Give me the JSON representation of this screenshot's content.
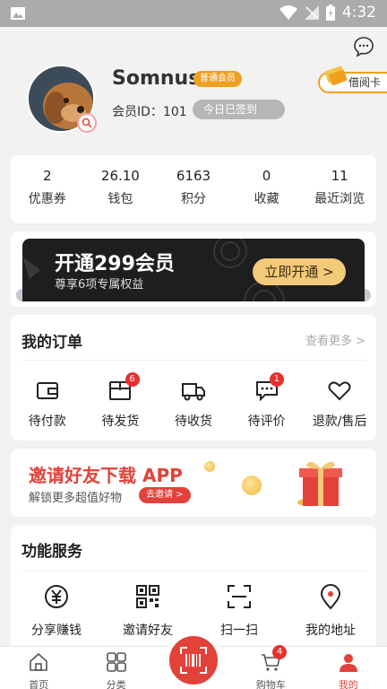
{
  "status_bar": {
    "time": "4:32"
  },
  "profile": {
    "username": "Somnus",
    "member_badge": "普通会员",
    "member_id": "会员ID：101",
    "signin_label": "今日已签到",
    "card_label": "借阅卡"
  },
  "stats": [
    {
      "value": "2",
      "label": "优惠券"
    },
    {
      "value": "26.10",
      "label": "钱包"
    },
    {
      "value": "6163",
      "label": "积分"
    },
    {
      "value": "0",
      "label": "收藏"
    },
    {
      "value": "11",
      "label": "最近浏览"
    }
  ],
  "vip": {
    "title": "开通299会员",
    "subtitle": "尊享6项专属权益",
    "button": "立即开通 >"
  },
  "orders": {
    "title": "我的订单",
    "more": "查看更多 >",
    "items": [
      {
        "label": "待付款",
        "icon": "wallet-icon",
        "badge": ""
      },
      {
        "label": "待发货",
        "icon": "box-icon",
        "badge": "6"
      },
      {
        "label": "待收货",
        "icon": "truck-icon",
        "badge": ""
      },
      {
        "label": "待评价",
        "icon": "comment-icon",
        "badge": "1"
      },
      {
        "label": "退款/售后",
        "icon": "heart-icon",
        "badge": ""
      }
    ]
  },
  "invite": {
    "title": "邀请好友下载 APP",
    "subtitle": "解锁更多超值好物",
    "button": "去邀请 >"
  },
  "services": {
    "title": "功能服务",
    "items": [
      {
        "label": "分享赚钱",
        "icon": "yen-icon"
      },
      {
        "label": "邀请好友",
        "icon": "qrcode-icon"
      },
      {
        "label": "扫一扫",
        "icon": "scan-icon"
      },
      {
        "label": "我的地址",
        "icon": "location-icon"
      }
    ]
  },
  "tabbar": {
    "items": [
      {
        "label": "首页",
        "icon": "home-icon"
      },
      {
        "label": "分类",
        "icon": "category-icon"
      },
      {
        "label": "",
        "icon": "barcode-scan-icon"
      },
      {
        "label": "购物车",
        "icon": "cart-icon",
        "badge": "4"
      },
      {
        "label": "我的",
        "icon": "user-icon"
      }
    ]
  },
  "colors": {
    "accent": "#e2423a",
    "gold": "#f0a020"
  }
}
